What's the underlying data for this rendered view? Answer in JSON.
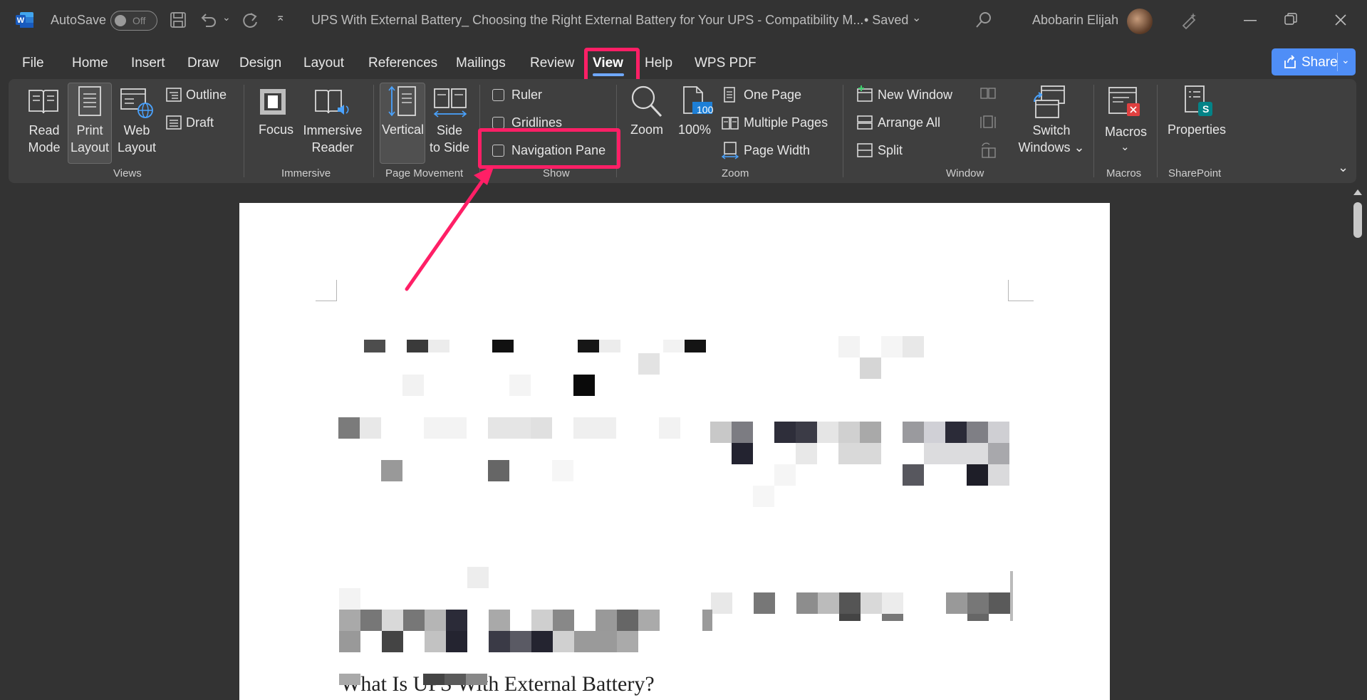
{
  "titlebar": {
    "autosave_label": "AutoSave",
    "autosave_state": "Off",
    "doc_title": "UPS With External Battery_ Choosing the Right External Battery for Your UPS  -  Compatibility M...",
    "saved_status": "• Saved",
    "user_name": "Abobarin Elijah"
  },
  "menu": {
    "file": "File",
    "home": "Home",
    "insert": "Insert",
    "draw": "Draw",
    "design": "Design",
    "layout": "Layout",
    "references": "References",
    "mailings": "Mailings",
    "review": "Review",
    "view": "View",
    "help": "Help",
    "wps_pdf": "WPS PDF",
    "share": "Share"
  },
  "ribbon": {
    "views": {
      "group_label": "Views",
      "read_mode_1": "Read",
      "read_mode_2": "Mode",
      "print_layout_1": "Print",
      "print_layout_2": "Layout",
      "web_layout_1": "Web",
      "web_layout_2": "Layout",
      "outline": "Outline",
      "draft": "Draft"
    },
    "immersive": {
      "group_label": "Immersive",
      "focus": "Focus",
      "reader_1": "Immersive",
      "reader_2": "Reader"
    },
    "page_movement": {
      "group_label": "Page Movement",
      "vertical": "Vertical",
      "side_1": "Side",
      "side_2": "to Side"
    },
    "show": {
      "group_label": "Show",
      "ruler": "Ruler",
      "gridlines": "Gridlines",
      "navigation_pane": "Navigation Pane"
    },
    "zoom": {
      "group_label": "Zoom",
      "zoom": "Zoom",
      "percent": "100%",
      "icon_badge": "100",
      "one_page": "One Page",
      "multiple_pages": "Multiple Pages",
      "page_width": "Page Width"
    },
    "window": {
      "group_label": "Window",
      "new_window": "New Window",
      "arrange_all": "Arrange All",
      "split": "Split",
      "switch_1": "Switch",
      "switch_2": "Windows ⌄"
    },
    "macros": {
      "group_label": "Macros",
      "macros": "Macros"
    },
    "sharepoint": {
      "group_label": "SharePoint",
      "properties": "Properties",
      "badge": "S"
    }
  },
  "document": {
    "heading_fragment": "What Is UPS With External Battery?"
  },
  "colors": {
    "accent": "#ff1f66",
    "share": "#4f8ef7",
    "ribbon_bg": "#3f3f3f",
    "titlebar_bg": "#333333"
  }
}
